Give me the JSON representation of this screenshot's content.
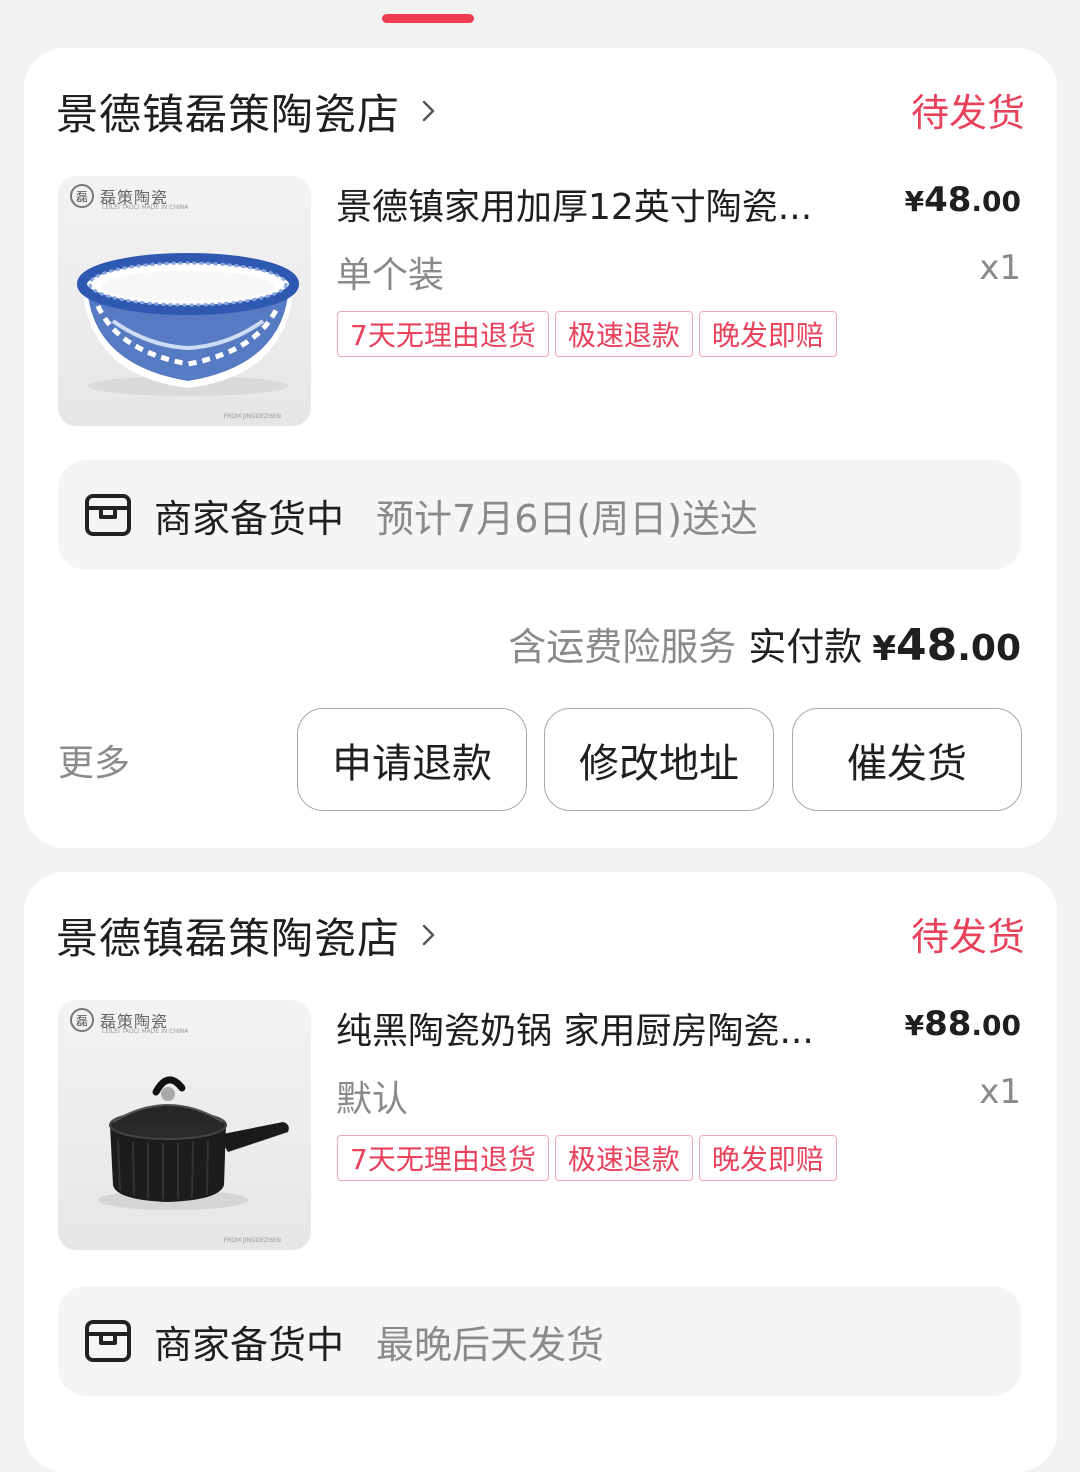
{
  "orders": [
    {
      "shop_name": "景德镇磊策陶瓷店",
      "status": "待发货",
      "product": {
        "title": "景德镇家用加厚12英寸陶瓷...",
        "price_symbol": "¥",
        "price_int": "48",
        "price_dec": ".00",
        "spec": "单个装",
        "qty": "x1",
        "image_logo": "磊策陶瓷",
        "image_logo_sub": "LEILEI TAOCI MADE IN CHINA",
        "image_footnote": "FROM JINGDEZHEN",
        "tags": [
          "7天无理由退货",
          "极速退款",
          "晚发即赔"
        ]
      },
      "shipping": {
        "state": "商家备货中",
        "eta": "预计7月6日(周日)送达"
      },
      "payment": {
        "insurance": "含运费险服务",
        "label": "实付款",
        "symbol": "¥",
        "int": "48",
        "dec": ".00"
      },
      "actions": {
        "more": "更多",
        "refund": "申请退款",
        "address": "修改地址",
        "urge": "催发货"
      }
    },
    {
      "shop_name": "景德镇磊策陶瓷店",
      "status": "待发货",
      "product": {
        "title": "纯黑陶瓷奶锅 家用厨房陶瓷...",
        "price_symbol": "¥",
        "price_int": "88",
        "price_dec": ".00",
        "spec": "默认",
        "qty": "x1",
        "image_logo": "磊策陶瓷",
        "image_logo_sub": "LEILEI TAOCI MADE IN CHINA",
        "image_footnote": "FROM JINGDEZHEN",
        "tags": [
          "7天无理由退货",
          "极速退款",
          "晚发即赔"
        ]
      },
      "shipping": {
        "state": "商家备货中",
        "eta": "最晚后天发货"
      }
    }
  ],
  "colors": {
    "accent": "#e8425c",
    "tag_border": "#f0a8b2",
    "muted": "#8a8a8a"
  },
  "icons": {
    "shop_chevron": "chevron-right-icon",
    "shipping": "package-box-icon"
  }
}
